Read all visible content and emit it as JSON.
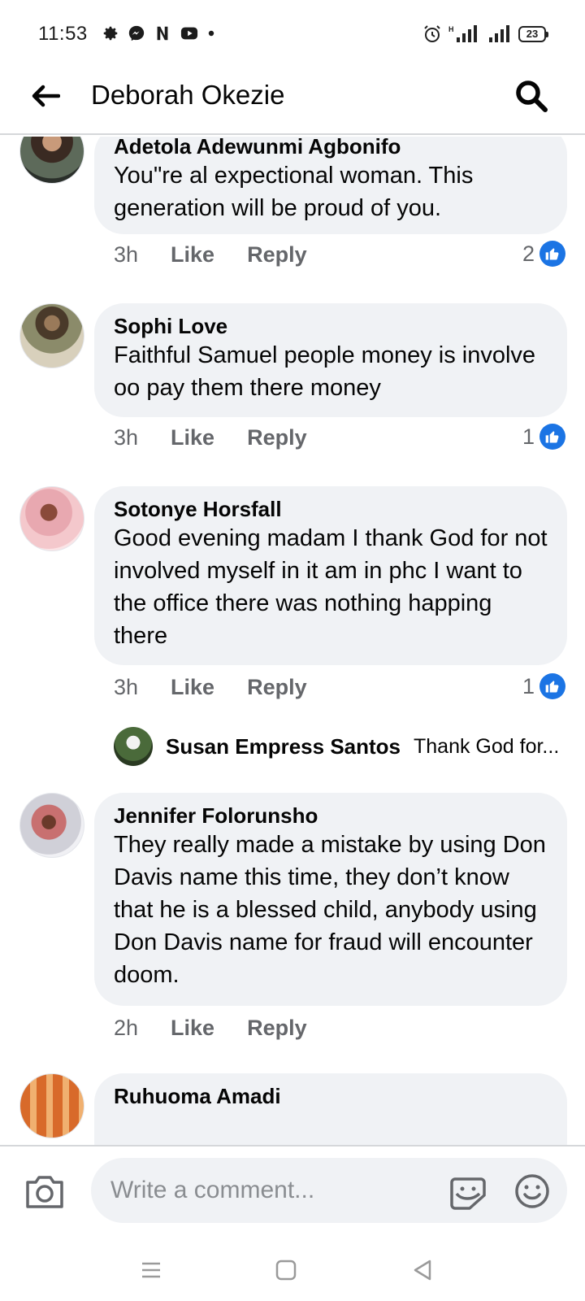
{
  "status_bar": {
    "time": "11:53",
    "battery": "23",
    "network": "H"
  },
  "header": {
    "title": "Deborah Okezie"
  },
  "comments": [
    {
      "author": "Adetola Adewunmi Agbonifo",
      "text": "You\"re al expectional woman. This generation will be proud of you.",
      "time": "3h",
      "like": "Like",
      "reply": "Reply",
      "reaction_count": "2"
    },
    {
      "author": "Sophi Love",
      "text": "Faithful Samuel people money is involve oo pay them there money",
      "time": "3h",
      "like": "Like",
      "reply": "Reply",
      "reaction_count": "1"
    },
    {
      "author": "Sotonye Horsfall",
      "text": "Good evening madam I thank God for not involved myself in it am in phc I want to the office there was nothing happing  there",
      "time": "3h",
      "like": "Like",
      "reply": "Reply",
      "reaction_count": "1",
      "reply_preview": {
        "author": "Susan Empress Santos",
        "text": "Thank God for..."
      }
    },
    {
      "author": "Jennifer Folorunsho",
      "text": "They really made a mistake by using Don Davis name this time, they don’t know that he is a blessed child, anybody using Don Davis name for fraud will encounter doom.",
      "time": "2h",
      "like": "Like",
      "reply": "Reply"
    },
    {
      "author": "Ruhuoma Amadi"
    }
  ],
  "composer": {
    "placeholder": "Write a comment..."
  },
  "colors": {
    "accent": "#1b74e4",
    "bubble": "#f0f2f5",
    "secondary_text": "#65676b"
  }
}
